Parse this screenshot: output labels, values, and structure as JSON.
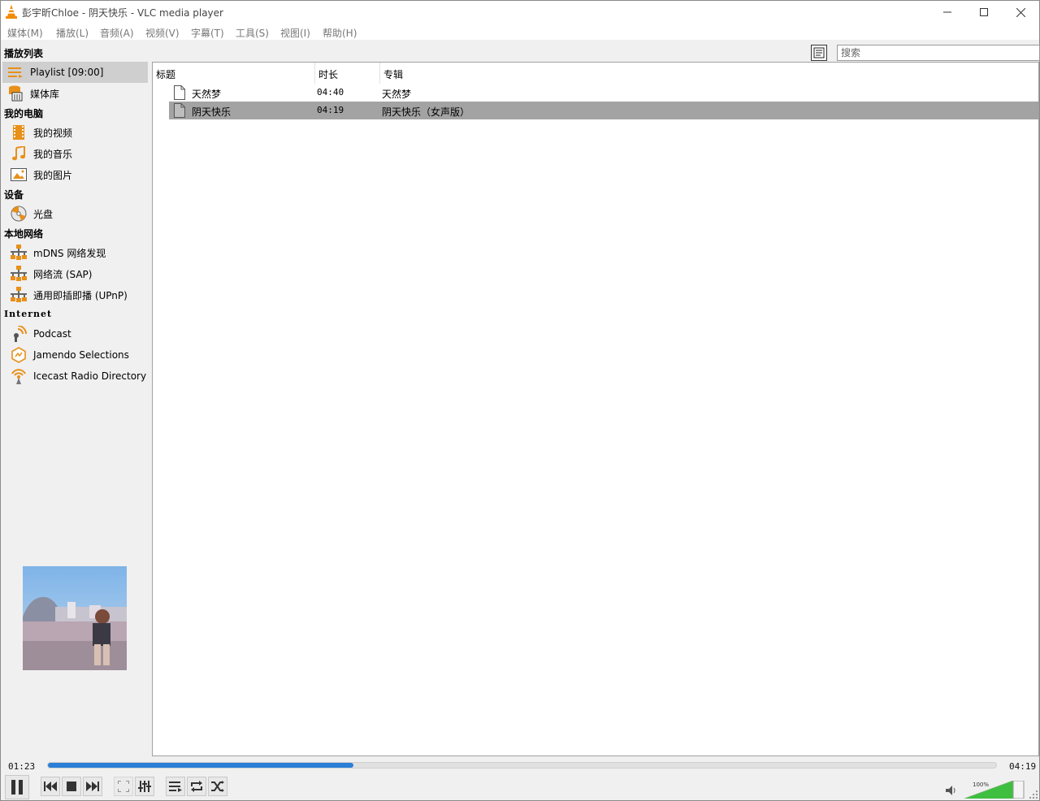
{
  "window": {
    "title": "彭宇昕Chloe - 阴天快乐 - VLC media player"
  },
  "menu": [
    "媒体(M)",
    "播放(L)",
    "音频(A)",
    "视频(V)",
    "字幕(T)",
    "工具(S)",
    "视图(I)",
    "帮助(H)"
  ],
  "search": {
    "placeholder": "搜索"
  },
  "sidebar": {
    "playlist_heading": "播放列表",
    "playlist_items": [
      {
        "label": "Playlist [09:00]",
        "icon": "playlist-icon",
        "selected": true
      },
      {
        "label": "媒体库",
        "icon": "media-library-icon",
        "selected": false
      }
    ],
    "computer_heading": "我的电脑",
    "computer_items": [
      {
        "label": "我的视频",
        "icon": "film-icon"
      },
      {
        "label": "我的音乐",
        "icon": "music-note-icon"
      },
      {
        "label": "我的图片",
        "icon": "picture-icon"
      }
    ],
    "devices_heading": "设备",
    "device_items": [
      {
        "label": "光盘",
        "icon": "disc-icon"
      }
    ],
    "network_heading": "本地网络",
    "network_items": [
      {
        "label": "mDNS 网络发现",
        "icon": "network-icon"
      },
      {
        "label": "网络流 (SAP)",
        "icon": "network-icon"
      },
      {
        "label": "通用即插即播 (UPnP)",
        "icon": "network-icon"
      }
    ],
    "internet_heading": "Internet",
    "internet_items": [
      {
        "label": "Podcast",
        "icon": "podcast-icon"
      },
      {
        "label": "Jamendo Selections",
        "icon": "jamendo-icon"
      },
      {
        "label": "Icecast Radio Directory",
        "icon": "icecast-icon"
      }
    ]
  },
  "playlist": {
    "columns": [
      "标题",
      "时长",
      "专辑"
    ],
    "rows": [
      {
        "title": "天然梦",
        "duration": "04:40",
        "album": "天然梦",
        "selected": false
      },
      {
        "title": "阴天快乐",
        "duration": "04:19",
        "album": "阴天快乐（女声版）",
        "selected": true
      }
    ]
  },
  "playback": {
    "elapsed": "01:23",
    "total": "04:19",
    "progress": 0.322,
    "volume_label": "100%",
    "volume": 1.0,
    "accent_color": "#2a7fd6",
    "volume_color": "#3fbf3f"
  }
}
